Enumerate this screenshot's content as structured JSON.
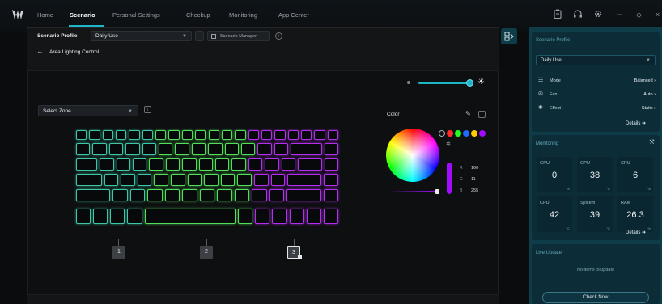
{
  "nav": {
    "tabs": [
      {
        "label": "Home"
      },
      {
        "label": "Scenario"
      },
      {
        "label": "Personal Settings"
      },
      {
        "label": "Checkup"
      },
      {
        "label": "Monitoring"
      },
      {
        "label": "App Center"
      }
    ],
    "active_tab": "Scenario",
    "window_icons": [
      "clipboard-icon",
      "headset-icon",
      "settings-icon",
      "minimize-icon",
      "restore-icon",
      "close-icon"
    ]
  },
  "scenario_bar": {
    "profile_label": "Scenario Profile",
    "profile_value": "Daily Use",
    "manager_label": "Scenario Manager"
  },
  "page": {
    "back_title": "Area Lighting Control"
  },
  "lighting": {
    "brightness_level": 1.0,
    "zone_select_label": "Select Zone",
    "zones": [
      "1",
      "2",
      "3"
    ],
    "color_title": "Color",
    "rgb": {
      "r_label": "R",
      "g_label": "G",
      "b_label": "B",
      "r": "160",
      "g": "11",
      "b": "255"
    },
    "preset_colors": [
      "#ffffff",
      "#ff2b2b",
      "#22ff22",
      "#1d6bff",
      "#ffcc00",
      "#a10bff"
    ],
    "accent": "#1fb5c9"
  },
  "right_panel": {
    "profile": {
      "title": "Scenario Profile",
      "value": "Daily Use",
      "rows": [
        {
          "label": "Mode",
          "value": "Balanced"
        },
        {
          "label": "Fan",
          "value": "Auto"
        },
        {
          "label": "Effect",
          "value": "Static"
        }
      ],
      "details": "Details"
    },
    "monitoring": {
      "title": "Monitoring",
      "tiles": [
        {
          "label": "GPU",
          "value": "0",
          "unit": "%"
        },
        {
          "label": "GPU",
          "value": "38",
          "unit": "°C"
        },
        {
          "label": "CPU",
          "value": "6",
          "unit": "%"
        },
        {
          "label": "CPU",
          "value": "42",
          "unit": "°C"
        },
        {
          "label": "System",
          "value": "39",
          "unit": "°C"
        },
        {
          "label": "RAM",
          "value": "26.3",
          "unit": "%"
        }
      ],
      "details": "Details"
    },
    "live_update": {
      "title": "Live Update",
      "message": "No items to update",
      "button": "Check Now"
    }
  }
}
